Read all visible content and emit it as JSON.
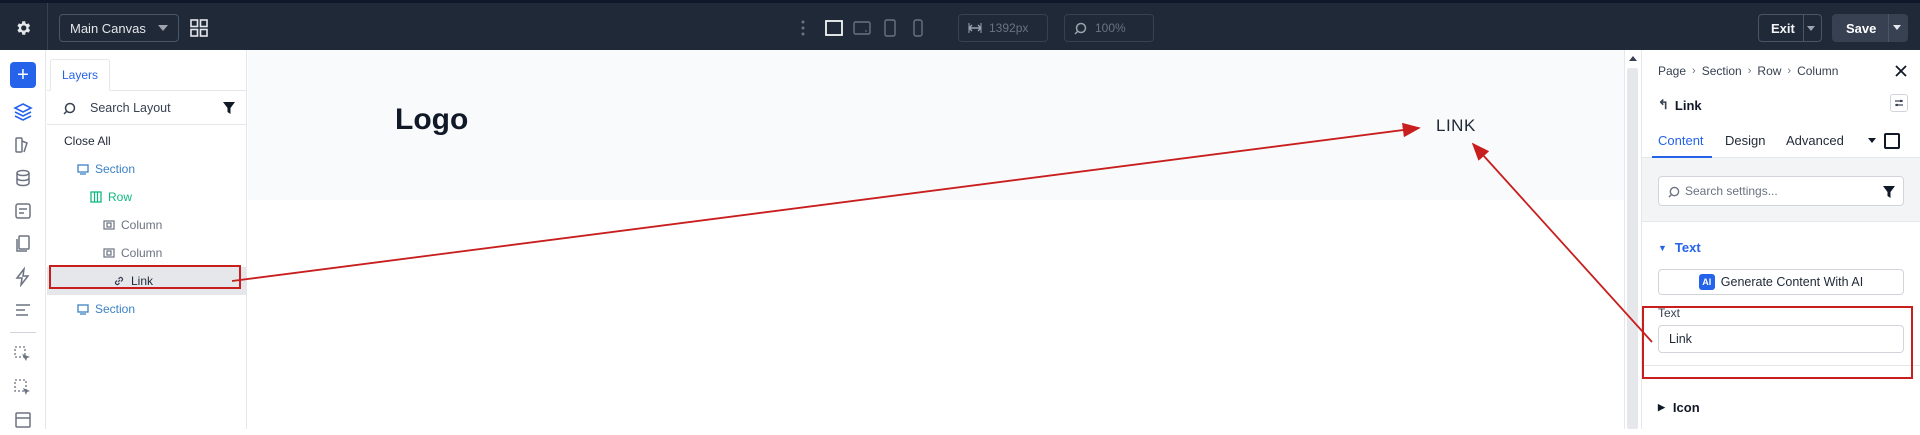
{
  "topbar": {
    "canvas_select": "Main Canvas",
    "width_value": "1392px",
    "zoom_value": "100%",
    "exit_label": "Exit",
    "save_label": "Save"
  },
  "layers": {
    "tab_label": "Layers",
    "search_placeholder": "Search Layout",
    "close_all": "Close All",
    "items": [
      {
        "label": "Section",
        "type": "section"
      },
      {
        "label": "Row",
        "type": "row"
      },
      {
        "label": "Column",
        "type": "column"
      },
      {
        "label": "Column",
        "type": "column"
      },
      {
        "label": "Link",
        "type": "link"
      },
      {
        "label": "Section",
        "type": "section"
      }
    ]
  },
  "canvas": {
    "logo": "Logo",
    "link_text": "LINK"
  },
  "panel": {
    "breadcrumb": [
      "Page",
      "Section",
      "Row",
      "Column"
    ],
    "element_title": "Link",
    "tabs": [
      "Content",
      "Design",
      "Advanced"
    ],
    "search_placeholder": "Search settings...",
    "group_text": "Text",
    "generate_label": "Generate Content With AI",
    "ai_badge": "AI",
    "field_label": "Text",
    "field_value": "Link",
    "group_icon": "Icon"
  },
  "colors": {
    "accent": "#2563eb",
    "topbar_bg": "#1f2937",
    "row_color": "#10b981",
    "section_color": "#3b82c4",
    "highlight": "#c81e1e"
  }
}
